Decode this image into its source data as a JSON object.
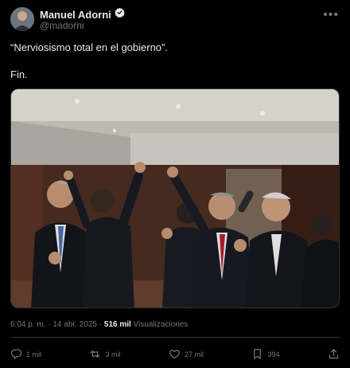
{
  "author": {
    "name": "Manuel Adorni",
    "handle": "@madorni",
    "verified": true
  },
  "post": {
    "line1": "“Nerviosismo total en el gobierno”.",
    "line2": "Fin."
  },
  "meta": {
    "time": "6:04 p. m.",
    "separator1": "·",
    "date": "14 abr. 2025",
    "separator2": "·",
    "views_count": "516 mil",
    "views_label": "Visualizaciones"
  },
  "actions": {
    "replies": "1 mil",
    "reposts": "3 mil",
    "likes": "27 mil",
    "bookmarks": "394"
  },
  "colors": {
    "background": "#000000",
    "text": "#e7e9ea",
    "muted": "#71767b",
    "divider": "#2f3336",
    "verified_badge": "#e7e9ea"
  }
}
